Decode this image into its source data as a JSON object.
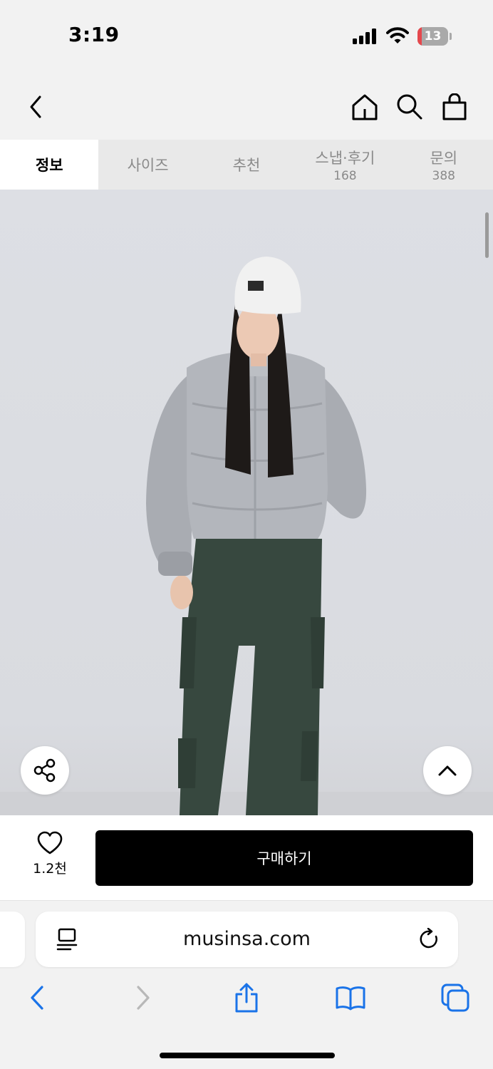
{
  "status_bar": {
    "time": "3:19",
    "battery_level": "13",
    "battery_fraction": 0.13,
    "icons": [
      "cellular-signal-icon",
      "wifi-icon",
      "battery-charging-icon"
    ]
  },
  "header": {
    "icons": [
      "back-chevron-icon",
      "home-icon",
      "search-icon",
      "shopping-bag-icon"
    ]
  },
  "tabs": [
    {
      "label": "정보",
      "count": ""
    },
    {
      "label": "사이즈",
      "count": ""
    },
    {
      "label": "추천",
      "count": ""
    },
    {
      "label": "스냅·후기",
      "count": "168"
    },
    {
      "label": "문의",
      "count": "388"
    }
  ],
  "product_image": {
    "icons": [
      "share-icon",
      "scroll-to-top-icon"
    ]
  },
  "purchase_bar": {
    "like_count": "1.2천",
    "buy_label": "구매하기",
    "icons": [
      "heart-icon"
    ]
  },
  "browser": {
    "url": "musinsa.com",
    "icons": [
      "page-menu-icon",
      "reload-icon",
      "back-icon",
      "forward-icon",
      "share-icon",
      "bookmarks-icon",
      "tabs-icon"
    ]
  },
  "colors": {
    "background": "#f2f2f2",
    "active_tab_bg": "#ffffff",
    "inactive_tab_text": "#8a8a8a",
    "buy_button": "#000000",
    "safari_blue": "#1a73e8",
    "battery_low": "#e5484d"
  }
}
